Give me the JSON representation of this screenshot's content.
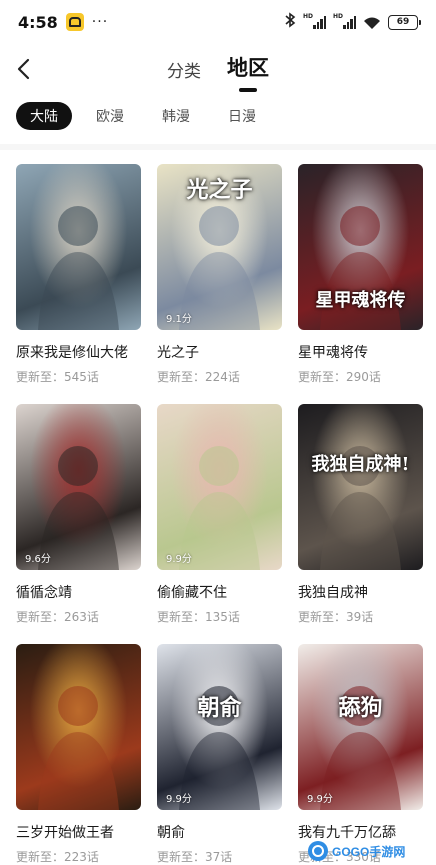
{
  "status_bar": {
    "time": "4:58",
    "more": "···",
    "battery": "69",
    "signal_tags": [
      "HD",
      "HD"
    ]
  },
  "header": {
    "tabs": [
      {
        "label": "分类",
        "active": false
      },
      {
        "label": "地区",
        "active": true
      }
    ]
  },
  "regions": [
    {
      "label": "大陆",
      "active": true
    },
    {
      "label": "欧漫",
      "active": false
    },
    {
      "label": "韩漫",
      "active": false
    },
    {
      "label": "日漫",
      "active": false
    }
  ],
  "comics": [
    {
      "title": "原来我是修仙大佬",
      "update": "更新至：545话",
      "score": "",
      "cover_text": "",
      "palette": [
        "#8fa6b5",
        "#3b4a55",
        "#d9d2c4"
      ]
    },
    {
      "title": "光之子",
      "update": "更新至：224话",
      "score": "9.1分",
      "cover_text": "光之子",
      "palette": [
        "#e9e3c5",
        "#7c8aa0",
        "#f5f0dc"
      ]
    },
    {
      "title": "星甲魂将传",
      "update": "更新至：290话",
      "score": "",
      "cover_text": "星甲魂将传",
      "palette": [
        "#2a2328",
        "#7a1e22",
        "#c9c9cf"
      ]
    },
    {
      "title": "循循念靖",
      "update": "更新至：263话",
      "score": "9.6分",
      "cover_text": "",
      "palette": [
        "#dcd4cf",
        "#2b2624",
        "#a3302f"
      ]
    },
    {
      "title": "偷偷藏不住",
      "update": "更新至：135话",
      "score": "9.9分",
      "cover_text": "",
      "palette": [
        "#e8d8c8",
        "#b9c78f",
        "#e9b7b1"
      ]
    },
    {
      "title": "我独自成神",
      "update": "更新至：39话",
      "score": "",
      "cover_text": "我独自成神!",
      "palette": [
        "#1d1c1f",
        "#5d544c",
        "#c7b79c"
      ]
    },
    {
      "title": "三岁开始做王者",
      "update": "更新至：223话",
      "score": "",
      "cover_text": "",
      "palette": [
        "#2a1d12",
        "#9c3a1c",
        "#e2a640"
      ]
    },
    {
      "title": "朝俞",
      "update": "更新至：37话",
      "score": "9.9分",
      "cover_text": "朝俞",
      "palette": [
        "#dfe3ea",
        "#1f2330",
        "#f2f2f4"
      ]
    },
    {
      "title": "我有九千万亿舔",
      "update": "更新至：330话",
      "score": "9.9分",
      "cover_text": "舔狗",
      "palette": [
        "#f1ede9",
        "#7d1f22",
        "#bfbfc4"
      ]
    }
  ],
  "watermark": {
    "text": "GOGO手游网"
  }
}
